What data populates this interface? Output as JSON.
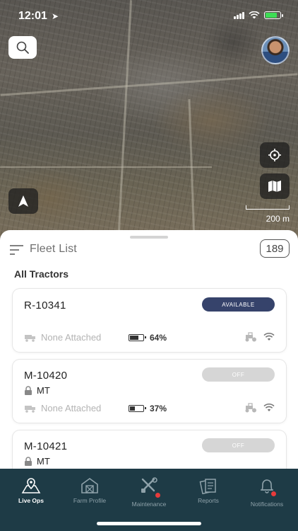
{
  "status_bar": {
    "time": "12:01"
  },
  "map": {
    "scale_label": "200 m"
  },
  "fleet": {
    "title": "Fleet List",
    "count": "189",
    "section_label": "All Tractors"
  },
  "tractors": [
    {
      "id": "R-10341",
      "status": "AVAILABLE",
      "attachment": "None Attached",
      "battery": "64%",
      "battery_level": 0.64
    },
    {
      "id": "M-10420",
      "status": "OFF",
      "lock_label": "MT",
      "attachment": "None Attached",
      "battery": "37%",
      "battery_level": 0.37
    },
    {
      "id": "M-10421",
      "status": "OFF",
      "lock_label": "MT"
    }
  ],
  "tabs": [
    {
      "label": "Live Ops",
      "icon": "map-pin-icon",
      "active": true
    },
    {
      "label": "Farm Profile",
      "icon": "barn-icon"
    },
    {
      "label": "Maintenance",
      "icon": "tools-icon",
      "notification": true
    },
    {
      "label": "Reports",
      "icon": "reports-icon"
    },
    {
      "label": "Notifications",
      "icon": "bell-icon",
      "notification": true
    }
  ],
  "colors": {
    "tab_bar": "#1e3b46",
    "available_pill": "#36436b",
    "off_pill": "#d6d6d6",
    "notification_dot": "#e83b3b"
  }
}
